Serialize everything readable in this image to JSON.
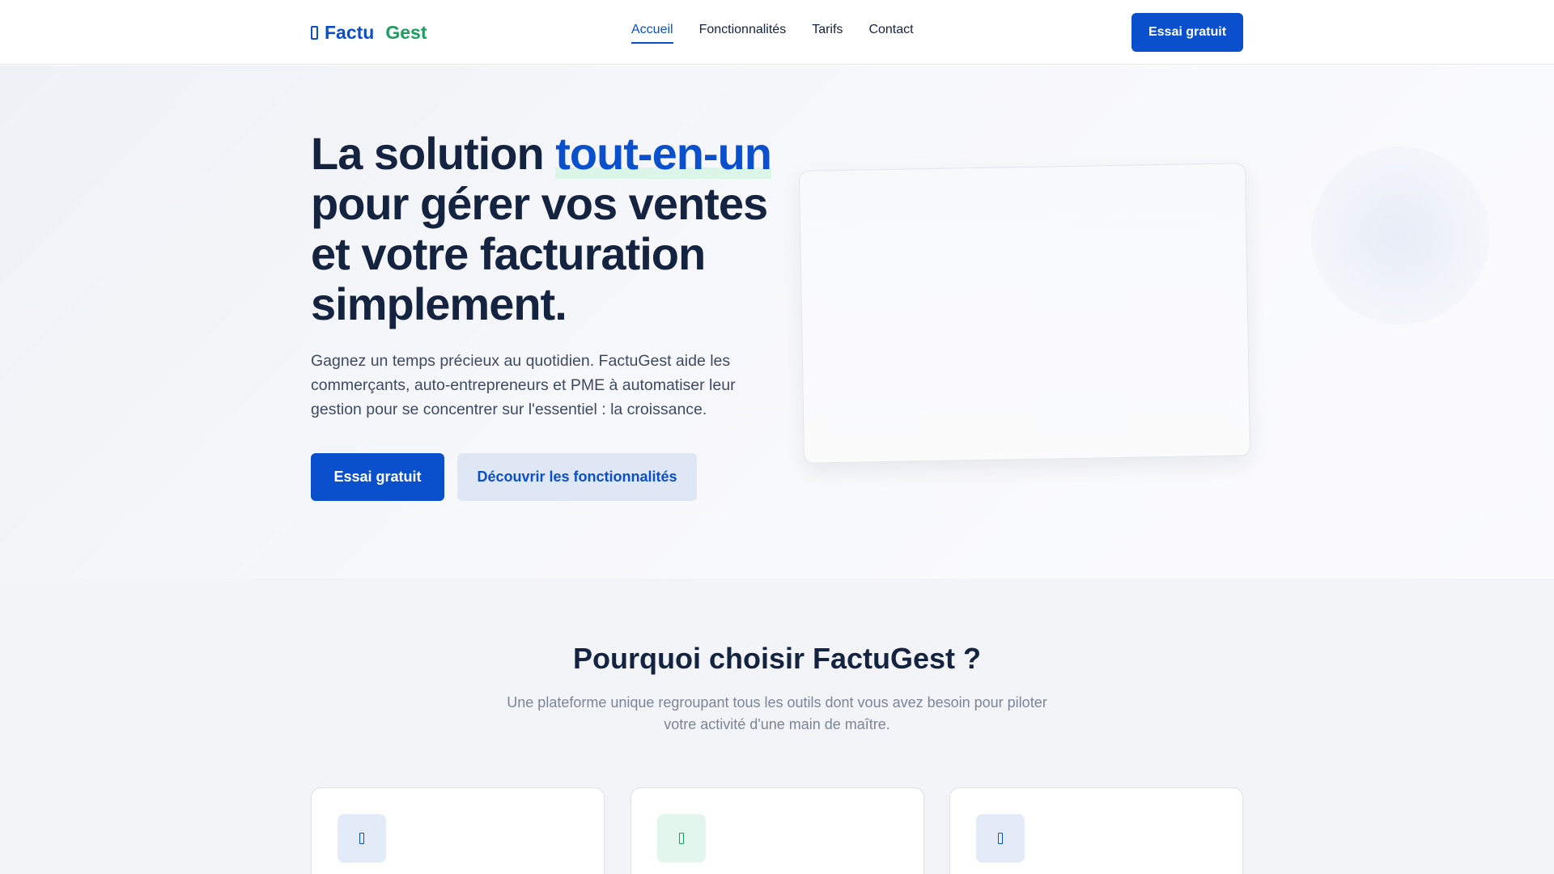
{
  "header": {
    "logo": {
      "part1": "Factu",
      "part2": "Gest",
      "icon": "app-logo-icon"
    },
    "nav": [
      {
        "label": "Accueil",
        "active": true
      },
      {
        "label": "Fonctionnalités",
        "active": false
      },
      {
        "label": "Tarifs",
        "active": false
      },
      {
        "label": "Contact",
        "active": false
      }
    ],
    "cta_label": "Essai gratuit"
  },
  "hero": {
    "title_before": "La solution ",
    "title_highlight": "tout-en-un",
    "title_after": " pour gérer vos ventes et votre facturation simplement.",
    "description": "Gagnez un temps précieux au quotidien. FactuGest aide les commerçants, auto-entrepreneurs et PME à automatiser leur gestion pour se concentrer sur l'essentiel : la croissance.",
    "primary_button": "Essai gratuit",
    "secondary_button": "Découvrir les fonctionnalités"
  },
  "features": {
    "title": "Pourquoi choisir FactuGest ?",
    "subtitle": "Une plateforme unique regroupant tous les outils dont vous avez besoin pour piloter votre activité d'une main de maître.",
    "cards": [
      {
        "icon": "feature-icon",
        "color": "#0a4fcc"
      },
      {
        "icon": "feature-icon",
        "color": "#1d9e60"
      },
      {
        "icon": "feature-icon",
        "color": "#0a4fcc"
      }
    ]
  },
  "colors": {
    "brand_blue": "#0a4fcc",
    "brand_green": "#1d9e60",
    "heading": "#14233f"
  }
}
